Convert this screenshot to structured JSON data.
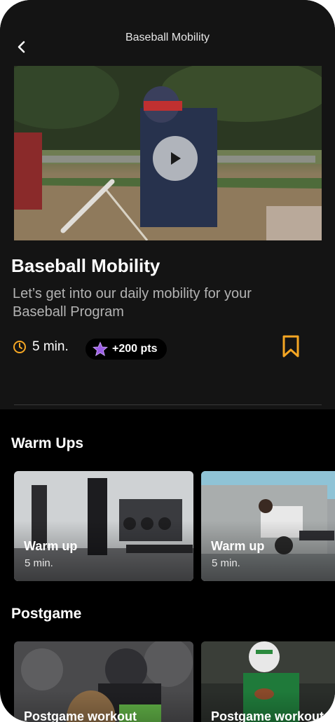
{
  "header": {
    "title": "Baseball Mobility"
  },
  "program": {
    "title": "Baseball Mobility",
    "description": "Let’s get into our daily mobility for your Baseball Program",
    "duration": "5 min.",
    "points": "+200 pts"
  },
  "sections": [
    {
      "title": "Warm Ups",
      "cards": [
        {
          "label": "Warm up",
          "duration": "5 min."
        },
        {
          "label": "Warm up",
          "duration": "5 min."
        }
      ]
    },
    {
      "title": "Postgame",
      "cards": [
        {
          "label": "Postgame workout"
        },
        {
          "label": "Postgame workout"
        }
      ]
    }
  ],
  "colors": {
    "accent": "#f5a623",
    "points_star": "#9b5de5",
    "background": "#000000",
    "panel": "#141414"
  },
  "icons": {
    "back": "chevron-left-icon",
    "play": "play-icon",
    "clock": "clock-icon",
    "star": "star-icon",
    "bookmark": "bookmark-icon"
  }
}
